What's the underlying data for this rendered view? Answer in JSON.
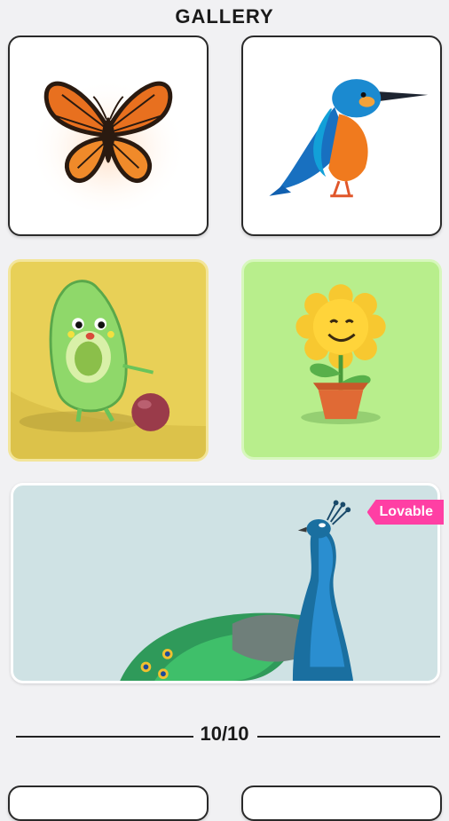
{
  "header": {
    "title": "GALLERY"
  },
  "cards": [
    {
      "subject": "butterfly"
    },
    {
      "subject": "kingfisher bird"
    },
    {
      "subject": "avocado character with ball"
    },
    {
      "subject": "sunflower in pot"
    },
    {
      "subject": "peacock",
      "badge": "Lovable"
    }
  ],
  "pagination": {
    "counter": "10/10"
  },
  "colors": {
    "background": "#f1f1f3",
    "badge": "#ff3fa4",
    "yellow_card": "#e8d057",
    "green_card": "#b8ee8c",
    "wide_card": "#cfe2e4"
  }
}
